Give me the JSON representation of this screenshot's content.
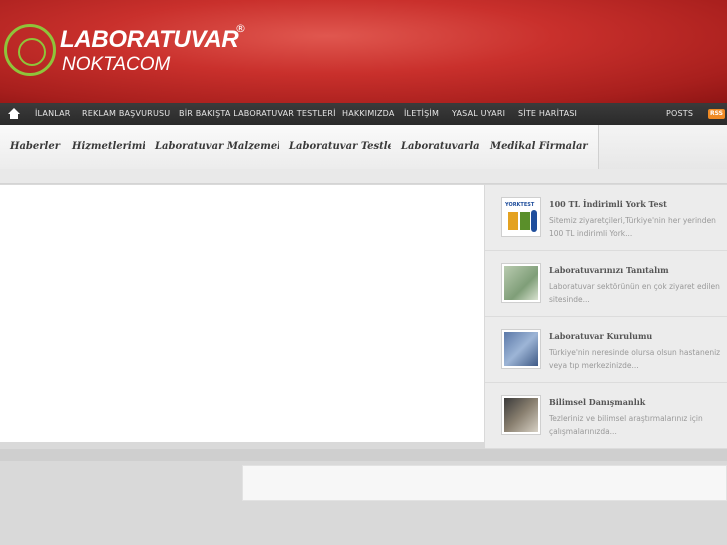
{
  "logo": {
    "title": "LABORATUVAR",
    "registered": "®",
    "subtitle": "NOKTACOM"
  },
  "topnav": {
    "home_icon": "home-icon",
    "items": [
      "İLANLAR",
      "REKLAM BAŞVURUSU",
      "BİR BAKIŞTA LABORATUVAR TESTLERİ",
      "HAKKIMIZDA",
      "İLETİŞİM",
      "YASAL UYARI",
      "SİTE HARİTASI"
    ],
    "posts": "POSTS",
    "rss": "RSS"
  },
  "categories": [
    "Haberler",
    "Hizmetlerimiz",
    "Laboratuvar Malzemeleri",
    "Laboratuvar Testleri",
    "Laboratuvarlar",
    "Medikal Firmalar"
  ],
  "sidebar": {
    "items": [
      {
        "title": "100 TL İndirimli York Test",
        "text": "Sitemiz ziyaretçileri,Türkiye'nin her yerinden 100 TL indirimli York...",
        "thumb_label": "YORKTEST"
      },
      {
        "title": "Laboratuvarınızı Tanıtalım",
        "text": "Laboratuvar sektörünün en çok ziyaret edilen sitesinde..."
      },
      {
        "title": "Laboratuvar Kurulumu",
        "text": "Türkiye'nin neresinde olursa olsun hastaneniz veya tıp merkezinizde..."
      },
      {
        "title": "Bilimsel Danışmanlık",
        "text": "Tezleriniz ve bilimsel araştırmalarınız için çalışmalarınızda..."
      }
    ]
  },
  "colors": {
    "header_red": "#c9302c",
    "logo_green": "#8fc43a",
    "nav_dark": "#2f2f2f"
  }
}
